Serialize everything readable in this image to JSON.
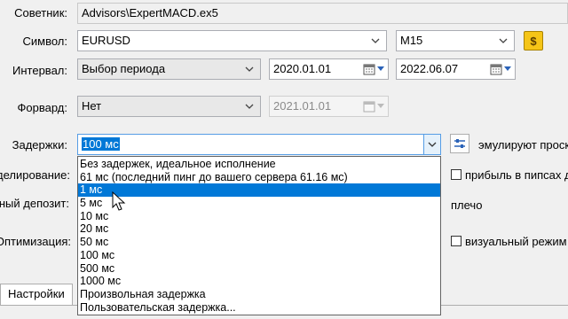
{
  "expert": {
    "label": "Советник:",
    "value": "Advisors\\ExpertMACD.ex5"
  },
  "symbol": {
    "label": "Символ:",
    "value": "EURUSD",
    "timeframe": "M15"
  },
  "interval": {
    "label": "Интервал:",
    "value": "Выбор периода",
    "date_from": "2020.01.01",
    "date_to": "2022.06.07"
  },
  "forward": {
    "label": "Форвард:",
    "value": "Нет",
    "date": "2021.01.01"
  },
  "delays": {
    "label": "Задержки:",
    "value": "100 мс",
    "emulate_label": "эмулируют проск",
    "options": [
      "Без задержек, идеальное исполнение",
      "61 мс (последний пинг до вашего сервера 61.16 мс)",
      "1 мс",
      "5 мс",
      "10 мс",
      "20 мс",
      "50 мс",
      "100 мс",
      "500 мс",
      "1000 мс",
      "Произвольная задержка",
      "Пользовательская задержка..."
    ],
    "highlighted": "1 мс"
  },
  "modeling": {
    "label": "делирование:",
    "checkbox_label": "прибыль в пипсах д"
  },
  "deposit": {
    "label": "ный депозит:",
    "leverage_label": "плечо"
  },
  "optimization": {
    "label": "Оптимизация:",
    "visual_label": "визуальный режим"
  },
  "tabs": {
    "settings": "Настройки"
  },
  "colors": {
    "selection": "#0078d7",
    "symbol_icon": "#f5c518"
  }
}
